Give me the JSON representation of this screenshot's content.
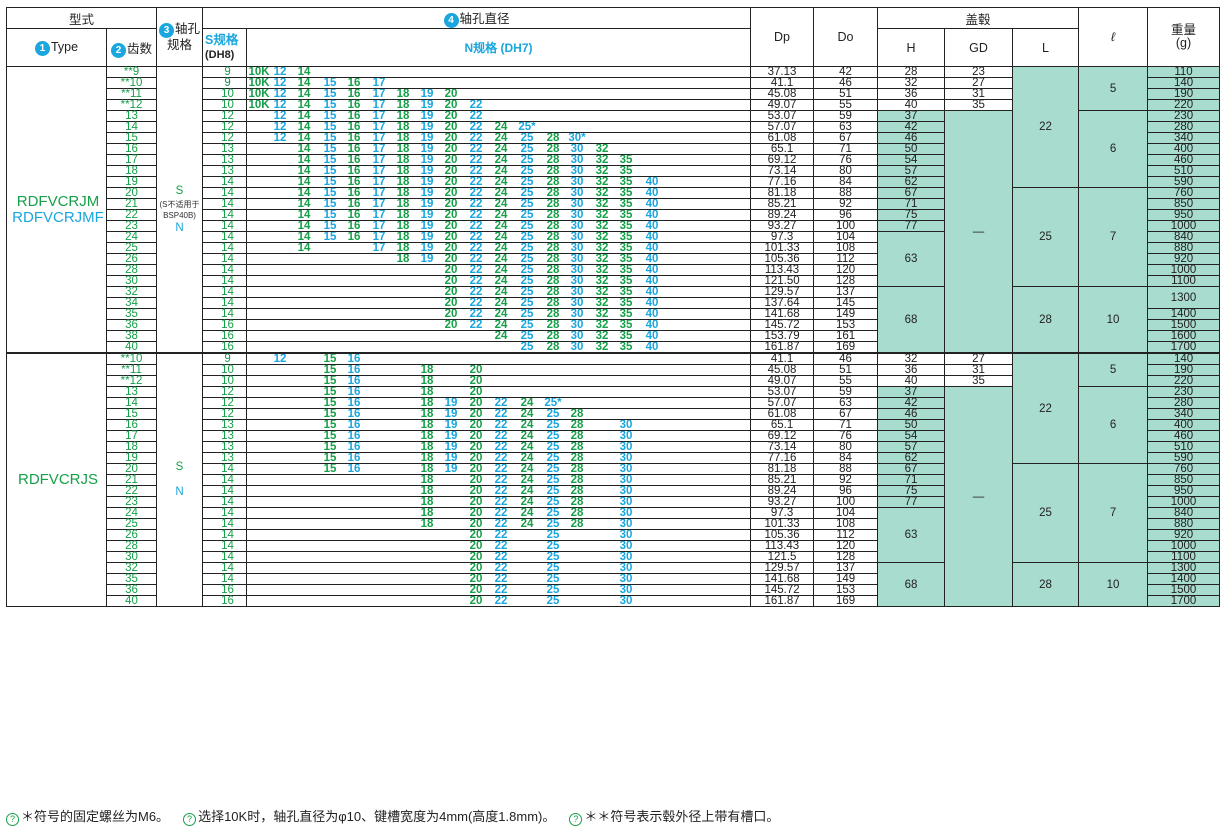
{
  "header": {
    "model_type": "型式",
    "type_label": "Type",
    "teeth_label": "齿数",
    "bore_spec_label_1": "轴孔",
    "bore_spec_label_2": "规格",
    "bore_dia_label": "轴孔直径",
    "s_spec_label": "S规格",
    "s_tol": "(DH8)",
    "n_spec_label": "N规格 (DH7)",
    "dp": "Dp",
    "do": "Do",
    "cover": "盖毂",
    "h": "H",
    "gd": "GD",
    "l": "L",
    "ell": "ℓ",
    "weight_1": "重量",
    "weight_2": "(g)",
    "num1": "1",
    "num2": "2",
    "num3": "3",
    "num4": "4"
  },
  "groups": [
    {
      "types": [
        "RDFVCRJM",
        "RDFVCRJMF"
      ],
      "spec": {
        "s": "S",
        "note": "(S不适用于BSP40B)",
        "n": "N"
      },
      "rows": [
        {
          "z": "**9",
          "s": "9",
          "bores": [
            "10K",
            "12",
            "14"
          ],
          "dp": "37.13",
          "do": "42",
          "h": "28",
          "gd": "23",
          "w": "110"
        },
        {
          "z": "**10",
          "s": "9",
          "bores": [
            "10K",
            "12",
            "14",
            "15",
            "16",
            "17"
          ],
          "dp": "41.1",
          "do": "46",
          "h": "32",
          "gd": "27",
          "w": "140"
        },
        {
          "z": "**11",
          "s": "10",
          "bores": [
            "10K",
            "12",
            "14",
            "15",
            "16",
            "17",
            "18",
            "19",
            "20"
          ],
          "dp": "45.08",
          "do": "51",
          "h": "36",
          "gd": "31",
          "w": "190"
        },
        {
          "z": "**12",
          "s": "10",
          "bores": [
            "10K",
            "12",
            "14",
            "15",
            "16",
            "17",
            "18",
            "19",
            "20",
            "22"
          ],
          "dp": "49.07",
          "do": "55",
          "h": "40",
          "gd": "35",
          "w": "220"
        },
        {
          "z": "13",
          "s": "12",
          "bores": [
            "12",
            "14",
            "15",
            "16",
            "17",
            "18",
            "19",
            "20",
            "22"
          ],
          "dp": "53.07",
          "do": "59",
          "h": "37",
          "w": "230"
        },
        {
          "z": "14",
          "s": "12",
          "bores": [
            "12",
            "14",
            "15",
            "16",
            "17",
            "18",
            "19",
            "20",
            "22",
            "24",
            "25*"
          ],
          "dp": "57.07",
          "do": "63",
          "h": "42",
          "w": "280"
        },
        {
          "z": "15",
          "s": "12",
          "bores": [
            "12",
            "14",
            "15",
            "16",
            "17",
            "18",
            "19",
            "20",
            "22",
            "24",
            "25",
            "28",
            "30*"
          ],
          "dp": "61.08",
          "do": "67",
          "h": "46",
          "w": "340"
        },
        {
          "z": "16",
          "s": "13",
          "bores": [
            "14",
            "15",
            "16",
            "17",
            "18",
            "19",
            "20",
            "22",
            "24",
            "25",
            "28",
            "30",
            "32"
          ],
          "dp": "65.1",
          "do": "71",
          "h": "50",
          "w": "400"
        },
        {
          "z": "17",
          "s": "13",
          "bores": [
            "14",
            "15",
            "16",
            "17",
            "18",
            "19",
            "20",
            "22",
            "24",
            "25",
            "28",
            "30",
            "32",
            "35"
          ],
          "dp": "69.12",
          "do": "76",
          "h": "54",
          "w": "460"
        },
        {
          "z": "18",
          "s": "13",
          "bores": [
            "14",
            "15",
            "16",
            "17",
            "18",
            "19",
            "20",
            "22",
            "24",
            "25",
            "28",
            "30",
            "32",
            "35"
          ],
          "dp": "73.14",
          "do": "80",
          "h": "57",
          "w": "510"
        },
        {
          "z": "19",
          "s": "14",
          "bores": [
            "14",
            "15",
            "16",
            "17",
            "18",
            "19",
            "20",
            "22",
            "24",
            "25",
            "28",
            "30",
            "32",
            "35",
            "40"
          ],
          "dp": "77.16",
          "do": "84",
          "h": "62",
          "w": "590"
        },
        {
          "z": "20",
          "s": "14",
          "bores": [
            "14",
            "15",
            "16",
            "17",
            "18",
            "19",
            "20",
            "22",
            "24",
            "25",
            "28",
            "30",
            "32",
            "35",
            "40"
          ],
          "dp": "81.18",
          "do": "88",
          "h": "67",
          "w": "760"
        },
        {
          "z": "21",
          "s": "14",
          "bores": [
            "14",
            "15",
            "16",
            "17",
            "18",
            "19",
            "20",
            "22",
            "24",
            "25",
            "28",
            "30",
            "32",
            "35",
            "40"
          ],
          "dp": "85.21",
          "do": "92",
          "h": "71",
          "w": "850"
        },
        {
          "z": "22",
          "s": "14",
          "bores": [
            "14",
            "15",
            "16",
            "17",
            "18",
            "19",
            "20",
            "22",
            "24",
            "25",
            "28",
            "30",
            "32",
            "35",
            "40"
          ],
          "dp": "89.24",
          "do": "96",
          "h": "75",
          "w": "950"
        },
        {
          "z": "23",
          "s": "14",
          "bores": [
            "14",
            "15",
            "16",
            "17",
            "18",
            "19",
            "20",
            "22",
            "24",
            "25",
            "28",
            "30",
            "32",
            "35",
            "40"
          ],
          "dp": "93.27",
          "do": "100",
          "h": "77",
          "w": "1000"
        },
        {
          "z": "24",
          "s": "14",
          "bores": [
            "14",
            "15",
            "16",
            "17",
            "18",
            "19",
            "20",
            "22",
            "24",
            "25",
            "28",
            "30",
            "32",
            "35",
            "40"
          ],
          "dp": "97.3",
          "do": "104",
          "w": "840"
        },
        {
          "z": "25",
          "s": "14",
          "bores": [
            "14",
            "17",
            "18",
            "19",
            "20",
            "22",
            "24",
            "25",
            "28",
            "30",
            "32",
            "35",
            "40"
          ],
          "dp": "101.33",
          "do": "108",
          "w": "880"
        },
        {
          "z": "26",
          "s": "14",
          "bores": [
            "18",
            "19",
            "20",
            "22",
            "24",
            "25",
            "28",
            "30",
            "32",
            "35",
            "40"
          ],
          "dp": "105.36",
          "do": "112",
          "w": "920"
        },
        {
          "z": "28",
          "s": "14",
          "bores": [
            "20",
            "22",
            "24",
            "25",
            "28",
            "30",
            "32",
            "35",
            "40"
          ],
          "dp": "113.43",
          "do": "120",
          "w": "1000"
        },
        {
          "z": "30",
          "s": "14",
          "bores": [
            "20",
            "22",
            "24",
            "25",
            "28",
            "30",
            "32",
            "35",
            "40"
          ],
          "dp": "121.50",
          "do": "128",
          "w": "1100"
        },
        {
          "z": "32",
          "s": "14",
          "bores": [
            "20",
            "22",
            "24",
            "25",
            "28",
            "30",
            "32",
            "35",
            "40"
          ],
          "dp": "129.57",
          "do": "137"
        },
        {
          "z": "34",
          "s": "14",
          "bores": [
            "20",
            "22",
            "24",
            "25",
            "28",
            "30",
            "32",
            "35",
            "40"
          ],
          "dp": "137.64",
          "do": "145"
        },
        {
          "z": "35",
          "s": "14",
          "bores": [
            "20",
            "22",
            "24",
            "25",
            "28",
            "30",
            "32",
            "35",
            "40"
          ],
          "dp": "141.68",
          "do": "149",
          "w": "1400"
        },
        {
          "z": "36",
          "s": "16",
          "bores": [
            "20",
            "22",
            "24",
            "25",
            "28",
            "30",
            "32",
            "35",
            "40"
          ],
          "dp": "145.72",
          "do": "153",
          "w": "1500"
        },
        {
          "z": "38",
          "s": "16",
          "bores": [
            "24",
            "25",
            "28",
            "30",
            "32",
            "35",
            "40"
          ],
          "dp": "153.79",
          "do": "161",
          "w": "1600"
        },
        {
          "z": "40",
          "s": "16",
          "bores": [
            "25",
            "28",
            "30",
            "32",
            "35",
            "40"
          ],
          "dp": "161.87",
          "do": "169",
          "w": "1700"
        }
      ],
      "merged": {
        "h_63": "63",
        "h_68": "68",
        "gd_dash": "—",
        "l_22": "22",
        "l_25": "25",
        "l_28": "28",
        "ell_5": "5",
        "ell_6": "6",
        "ell_7": "7",
        "ell_10": "10",
        "w_1300": "1300"
      }
    },
    {
      "types": [
        "RDFVCRJS"
      ],
      "spec": {
        "s": "S",
        "n": "N"
      },
      "rows": [
        {
          "z": "**10",
          "s": "9",
          "bores": [
            "12",
            "15",
            "16"
          ],
          "dp": "41.1",
          "do": "46",
          "h": "32",
          "gd": "27",
          "w": "140"
        },
        {
          "z": "**11",
          "s": "10",
          "bores": [
            "15",
            "16",
            "18",
            "20"
          ],
          "dp": "45.08",
          "do": "51",
          "h": "36",
          "gd": "31",
          "w": "190"
        },
        {
          "z": "**12",
          "s": "10",
          "bores": [
            "15",
            "16",
            "18",
            "20"
          ],
          "dp": "49.07",
          "do": "55",
          "h": "40",
          "gd": "35",
          "w": "220"
        },
        {
          "z": "13",
          "s": "12",
          "bores": [
            "15",
            "16",
            "18",
            "20"
          ],
          "dp": "53.07",
          "do": "59",
          "h": "37",
          "w": "230"
        },
        {
          "z": "14",
          "s": "12",
          "bores": [
            "15",
            "16",
            "18",
            "19",
            "20",
            "22",
            "24",
            "25*"
          ],
          "dp": "57.07",
          "do": "63",
          "h": "42",
          "w": "280"
        },
        {
          "z": "15",
          "s": "12",
          "bores": [
            "15",
            "16",
            "18",
            "19",
            "20",
            "22",
            "24",
            "25",
            "28"
          ],
          "dp": "61.08",
          "do": "67",
          "h": "46",
          "w": "340"
        },
        {
          "z": "16",
          "s": "13",
          "bores": [
            "15",
            "16",
            "18",
            "19",
            "20",
            "22",
            "24",
            "25",
            "28",
            "30"
          ],
          "dp": "65.1",
          "do": "71",
          "h": "50",
          "w": "400"
        },
        {
          "z": "17",
          "s": "13",
          "bores": [
            "15",
            "16",
            "18",
            "19",
            "20",
            "22",
            "24",
            "25",
            "28",
            "30"
          ],
          "dp": "69.12",
          "do": "76",
          "h": "54",
          "w": "460"
        },
        {
          "z": "18",
          "s": "13",
          "bores": [
            "15",
            "16",
            "18",
            "19",
            "20",
            "22",
            "24",
            "25",
            "28",
            "30"
          ],
          "dp": "73.14",
          "do": "80",
          "h": "57",
          "w": "510"
        },
        {
          "z": "19",
          "s": "13",
          "bores": [
            "15",
            "16",
            "18",
            "19",
            "20",
            "22",
            "24",
            "25",
            "28",
            "30"
          ],
          "dp": "77.16",
          "do": "84",
          "h": "62",
          "w": "590"
        },
        {
          "z": "20",
          "s": "14",
          "bores": [
            "15",
            "16",
            "18",
            "19",
            "20",
            "22",
            "24",
            "25",
            "28",
            "30"
          ],
          "dp": "81.18",
          "do": "88",
          "h": "67",
          "w": "760"
        },
        {
          "z": "21",
          "s": "14",
          "bores": [
            "18",
            "20",
            "22",
            "24",
            "25",
            "28",
            "30"
          ],
          "dp": "85.21",
          "do": "92",
          "h": "71",
          "w": "850"
        },
        {
          "z": "22",
          "s": "14",
          "bores": [
            "18",
            "20",
            "22",
            "24",
            "25",
            "28",
            "30"
          ],
          "dp": "89.24",
          "do": "96",
          "h": "75",
          "w": "950"
        },
        {
          "z": "23",
          "s": "14",
          "bores": [
            "18",
            "20",
            "22",
            "24",
            "25",
            "28",
            "30"
          ],
          "dp": "93.27",
          "do": "100",
          "h": "77",
          "w": "1000"
        },
        {
          "z": "24",
          "s": "14",
          "bores": [
            "18",
            "20",
            "22",
            "24",
            "25",
            "28",
            "30"
          ],
          "dp": "97.3",
          "do": "104",
          "w": "840"
        },
        {
          "z": "25",
          "s": "14",
          "bores": [
            "18",
            "20",
            "22",
            "24",
            "25",
            "28",
            "30"
          ],
          "dp": "101.33",
          "do": "108",
          "w": "880"
        },
        {
          "z": "26",
          "s": "14",
          "bores": [
            "20",
            "22",
            "25",
            "30"
          ],
          "dp": "105.36",
          "do": "112",
          "w": "920"
        },
        {
          "z": "28",
          "s": "14",
          "bores": [
            "20",
            "22",
            "25",
            "30"
          ],
          "dp": "113.43",
          "do": "120",
          "w": "1000"
        },
        {
          "z": "30",
          "s": "14",
          "bores": [
            "20",
            "22",
            "25",
            "30"
          ],
          "dp": "121.5",
          "do": "128",
          "w": "1100"
        },
        {
          "z": "32",
          "s": "14",
          "bores": [
            "20",
            "22",
            "25",
            "30"
          ],
          "dp": "129.57",
          "do": "137",
          "w": "1300"
        },
        {
          "z": "35",
          "s": "14",
          "bores": [
            "20",
            "22",
            "25",
            "30"
          ],
          "dp": "141.68",
          "do": "149",
          "w": "1400"
        },
        {
          "z": "36",
          "s": "16",
          "bores": [
            "20",
            "22",
            "25",
            "30"
          ],
          "dp": "145.72",
          "do": "153",
          "w": "1500"
        },
        {
          "z": "40",
          "s": "16",
          "bores": [
            "20",
            "22",
            "25",
            "30"
          ],
          "dp": "161.87",
          "do": "169",
          "w": "1700"
        }
      ],
      "merged": {
        "h_63": "63",
        "h_68": "68",
        "gd_dash": "—",
        "l_22": "22",
        "l_25": "25",
        "l_28": "28",
        "ell_5": "5",
        "ell_6": "6",
        "ell_7": "7",
        "ell_10": "10"
      }
    }
  ],
  "notes": {
    "n1": "＊符号的固定螺丝为M6。",
    "n2": "选择10K时，轴孔直径为φ10、键槽宽度为4mm(高度1.8mm)。",
    "n3": "＊＊符号表示毂外径上带有槽口。"
  },
  "colors": {
    "cyan": "#1aa6de",
    "green": "#16a049",
    "teal_fill": "#a8dccf"
  }
}
